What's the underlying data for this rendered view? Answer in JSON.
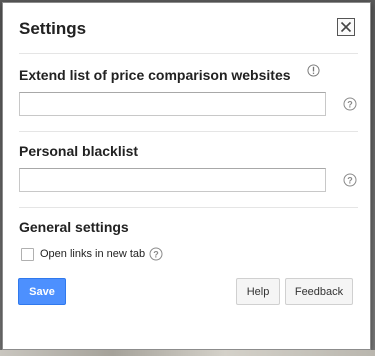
{
  "dialog": {
    "title": "Settings",
    "close_icon": "close-icon"
  },
  "sections": {
    "extend": {
      "label": "Extend list of price comparison websites",
      "info_icon": "info-icon",
      "input_value": "",
      "input_placeholder": "",
      "help_icon": "question-mark-icon"
    },
    "blacklist": {
      "label": "Personal blacklist",
      "input_value": "",
      "input_placeholder": "",
      "help_icon": "question-mark-icon"
    },
    "general": {
      "label": "General settings",
      "open_links_label": "Open links in new tab",
      "open_links_checked": false,
      "help_icon": "question-mark-icon"
    }
  },
  "buttons": {
    "save": "Save",
    "help": "Help",
    "feedback": "Feedback"
  },
  "colors": {
    "save_button": "#4d90fe",
    "divider": "#e5e5e5",
    "text": "#222222"
  }
}
